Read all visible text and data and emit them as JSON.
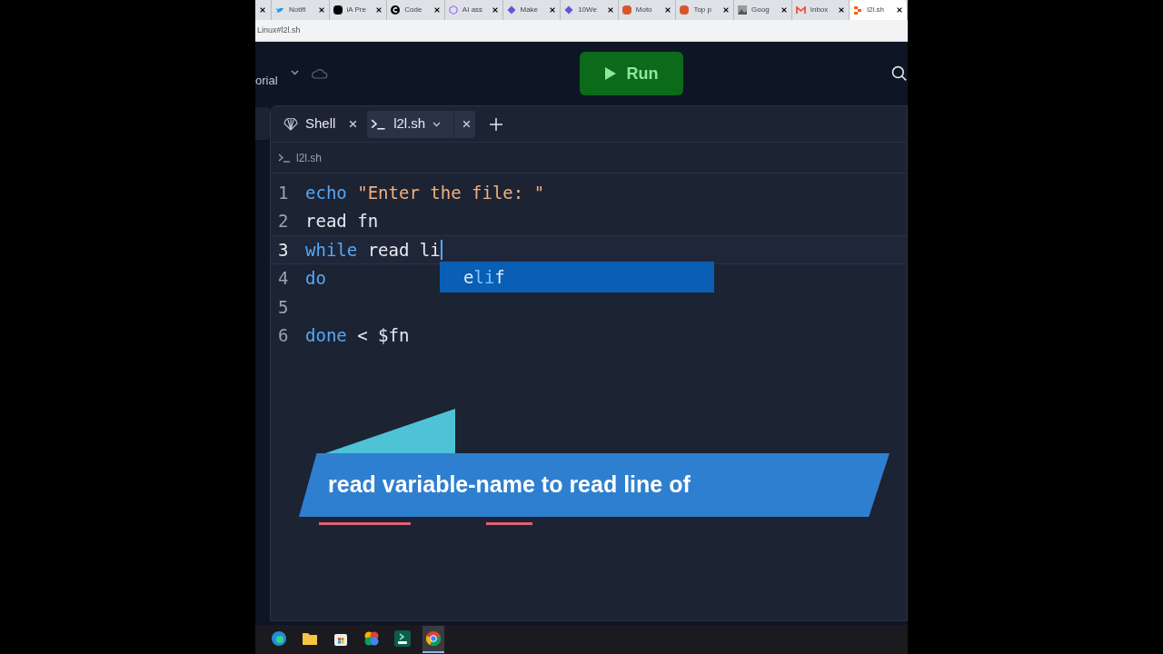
{
  "browser_tabs": [
    {
      "selected": false
    },
    {
      "label": "Notifi",
      "selected": false
    },
    {
      "label": "iA Pre",
      "selected": false
    },
    {
      "label": "Code",
      "selected": false
    },
    {
      "label": "AI ass",
      "selected": false
    },
    {
      "label": "Make",
      "selected": false
    },
    {
      "label": "10We",
      "selected": false
    },
    {
      "label": "Moto",
      "selected": false
    },
    {
      "label": "Top p",
      "selected": false
    },
    {
      "label": "Goog",
      "selected": false
    },
    {
      "label": "Inbox",
      "selected": false
    },
    {
      "label": "l2l.sh",
      "selected": true
    }
  ],
  "address": "Linux#l2l.sh",
  "header": {
    "project": "orial",
    "run": "Run"
  },
  "editor_tabs": [
    {
      "label": "Shell",
      "selected": false,
      "kind": "shell"
    },
    {
      "label": "l2l.sh",
      "selected": true,
      "kind": "file"
    }
  ],
  "breadcrumb": "l2l.sh",
  "code_lines": [
    {
      "number": "1",
      "current": false,
      "tokens": [
        {
          "text": "echo",
          "kind": "keyword"
        },
        {
          "text": " \"Enter the file: \"",
          "kind": "string"
        }
      ]
    },
    {
      "number": "2",
      "current": false,
      "tokens": [
        {
          "text": "read fn",
          "kind": "plain"
        }
      ]
    },
    {
      "number": "3",
      "current": true,
      "tokens": [
        {
          "text": "while",
          "kind": "keyword"
        },
        {
          "text": " read li",
          "kind": "plain"
        }
      ]
    },
    {
      "number": "4",
      "current": false,
      "tokens": [
        {
          "text": "do",
          "kind": "keyword"
        }
      ]
    },
    {
      "number": "5",
      "current": false
    },
    {
      "number": "6",
      "current": false,
      "tokens": [
        {
          "text": "done",
          "kind": "keyword"
        },
        {
          "text": " < $fn",
          "kind": "plain"
        }
      ]
    }
  ],
  "autocomplete": [
    {
      "text": "e",
      "match": false
    },
    {
      "text": "li",
      "match": true
    },
    {
      "text": "f",
      "match": false
    }
  ],
  "caption": "read variable-name to read line of",
  "taskbar": [
    {
      "kind": "edge",
      "selected": false
    },
    {
      "kind": "folder",
      "selected": false
    },
    {
      "kind": "store",
      "selected": false
    },
    {
      "kind": "photos",
      "selected": false
    },
    {
      "kind": "terminal",
      "selected": false
    },
    {
      "kind": "chrome",
      "selected": true
    }
  ]
}
